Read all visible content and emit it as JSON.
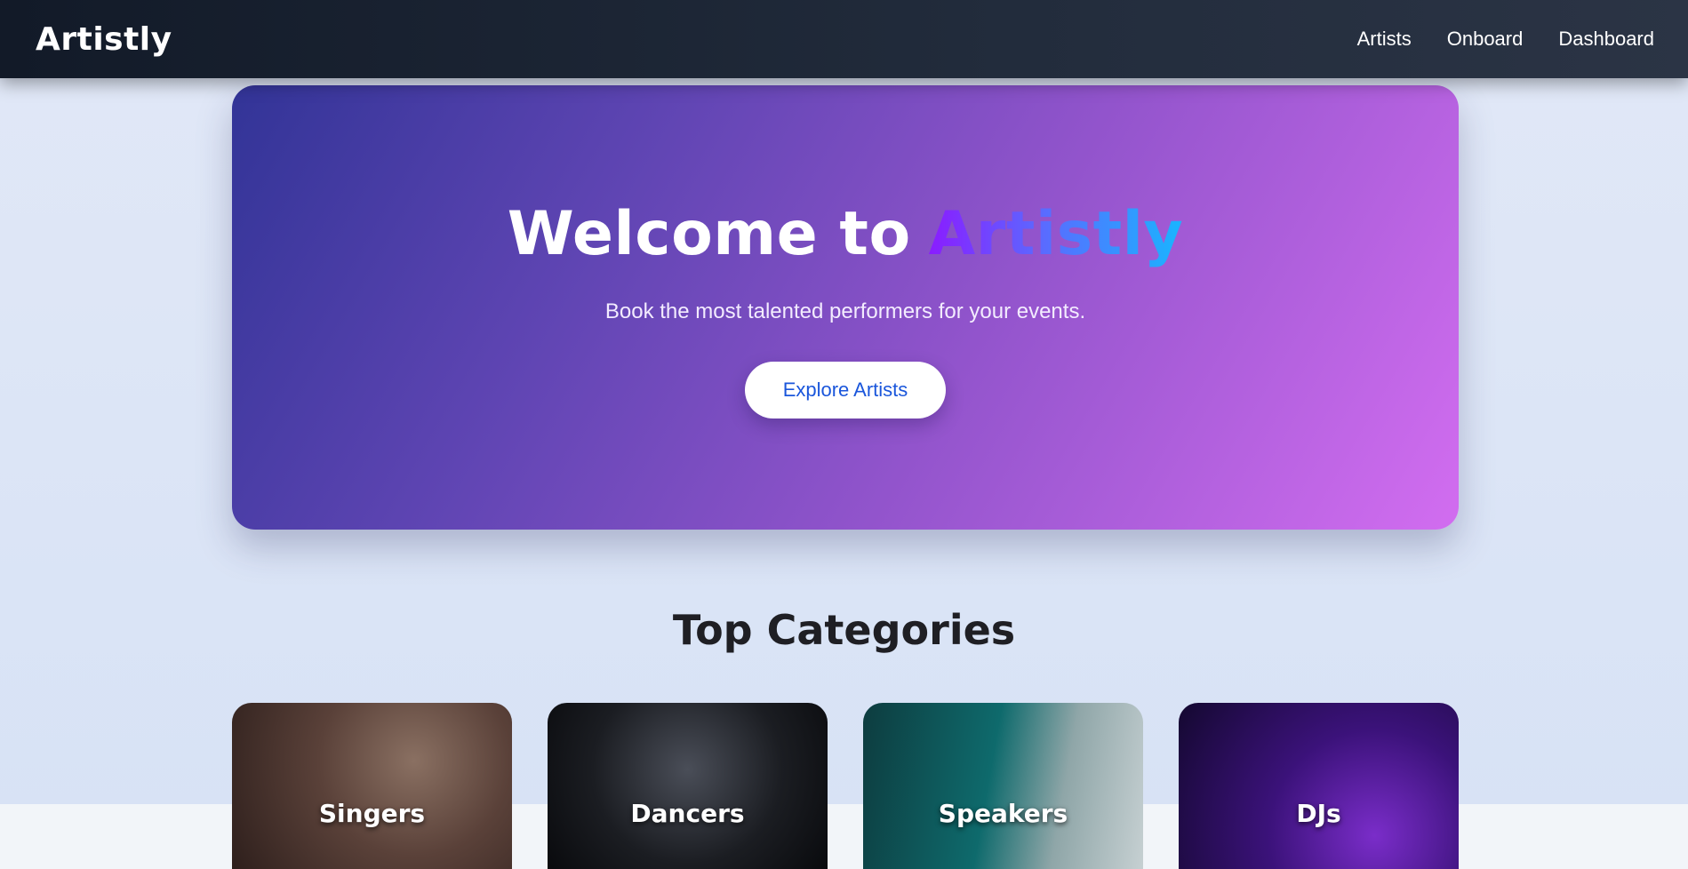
{
  "nav": {
    "brand": "Artistly",
    "links": [
      "Artists",
      "Onboard",
      "Dashboard"
    ]
  },
  "hero": {
    "title_prefix": "Welcome to",
    "title_accent": "Artistly",
    "subtitle": "Book the most talented performers for your events.",
    "button_label": "Explore Artists"
  },
  "categories": {
    "title": "Top Categories",
    "items": [
      {
        "label": "Singers"
      },
      {
        "label": "Dancers"
      },
      {
        "label": "Speakers"
      },
      {
        "label": "DJs"
      }
    ]
  },
  "colors": {
    "navbar": "#1a2230",
    "hero_start": "#323497",
    "hero_end": "#d26df0",
    "button_text": "#1a56db",
    "page_bg": "#dde6f6"
  }
}
